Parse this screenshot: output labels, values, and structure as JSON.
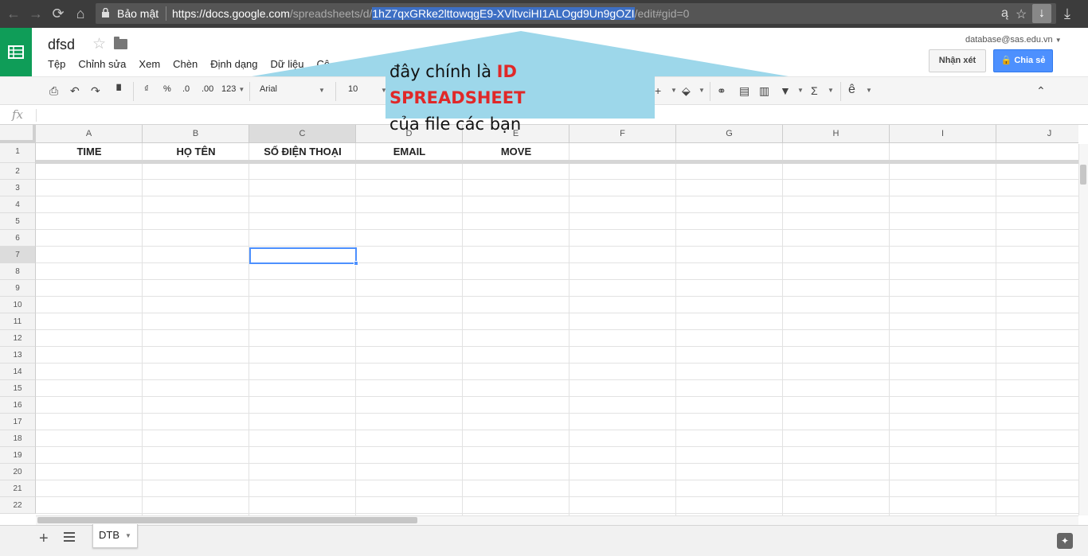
{
  "browser": {
    "security_label": "Bảo mật",
    "url_base": "https://docs.google.com",
    "url_path": "/spreadsheets/d/",
    "url_id": "1hZ7qxGRke2lttowqgE9-XVltvciHI1ALOgd9Un9gOZI",
    "url_tail": "/edit#gid=0",
    "translate_icon": "ą"
  },
  "doc": {
    "title": "dfsd",
    "menu": [
      "Tệp",
      "Chỉnh sửa",
      "Xem",
      "Chèn",
      "Định dạng",
      "Dữ liệu",
      "Cô"
    ],
    "account": "database@sas.edu.vn",
    "comment_label": "Nhận xét",
    "share_label": "Chia sẻ"
  },
  "toolbar": {
    "currency": "₫",
    "percent": "%",
    "dec_less": ".0",
    "dec_more": ".00",
    "more_formats": "123",
    "font": "Arial",
    "font_size": "10",
    "input_tools": "ê",
    "sum": "Σ"
  },
  "formula_bar": {
    "fx_label": "fx"
  },
  "grid": {
    "columns": [
      "A",
      "B",
      "C",
      "D",
      "E",
      "F",
      "G",
      "H",
      "I",
      "J"
    ],
    "rows": [
      "1",
      "2",
      "3",
      "4",
      "5",
      "6",
      "7",
      "8",
      "9",
      "10",
      "11",
      "12",
      "13",
      "14",
      "15",
      "16",
      "17",
      "18",
      "19",
      "20",
      "21",
      "22"
    ],
    "headers": [
      "TIME",
      "HỌ TÊN",
      "SỐ ĐIỆN THOẠI",
      "EMAIL",
      "MOVE"
    ],
    "selected_cell": "C7"
  },
  "sheets": {
    "active_tab": "DTB"
  },
  "callout": {
    "line1_prefix": "đây chính là ",
    "line1_highlight": "ID SPREADSHEET",
    "line2": "của file các bạn",
    "highlight_color": "#e02828",
    "fill_color": "#9dd7ea"
  },
  "colors": {
    "sheets_green": "#0f9d58",
    "share_blue": "#4d90fe",
    "url_highlight": "#3d6fc4"
  }
}
